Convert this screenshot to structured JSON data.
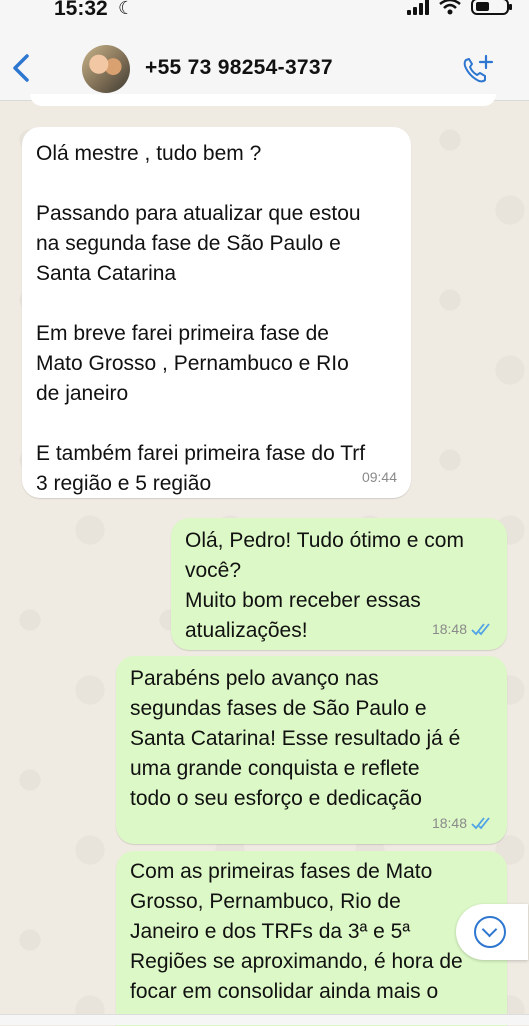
{
  "status_bar": {
    "time": "15:32",
    "moon": "☾",
    "icons": [
      "moon-icon",
      "signal-icon",
      "wifi-icon",
      "battery-icon"
    ]
  },
  "header": {
    "contact_name": "+55 73 98254-3737",
    "back_icon": "chevron-left-icon",
    "call_icon": "add-call-icon"
  },
  "messages": [
    {
      "direction": "incoming",
      "text": "Olá mestre , tudo bem ?\n\nPassando para atualizar que estou\nna segunda fase de São Paulo e\nSanta Catarina\n\nEm breve farei primeira fase de\nMato Grosso , Pernambuco e RIo\nde janeiro\n\nE também farei primeira fase do Trf\n3 região e 5 região",
      "time": "09:44"
    },
    {
      "direction": "outgoing",
      "text": "Olá, Pedro! Tudo ótimo e com\nvocê?\nMuito bom receber essas\natualizações!",
      "time": "18:48",
      "read": true
    },
    {
      "direction": "outgoing",
      "text": "Parabéns pelo avanço nas\nsegundas fases de São Paulo e\nSanta Catarina! Esse resultado já é\numa grande conquista e reflete\ntodo o seu esforço e dedicação",
      "time": "18:48",
      "read": true
    },
    {
      "direction": "outgoing",
      "text": "Com as primeiras fases de Mato\nGrosso, Pernambuco, Rio de\nJaneiro e dos TRFs da 3ª e 5ª\nRegiões se aproximando, é hora de\nfocar em consolidar ainda mais o"
    }
  ],
  "colors": {
    "incoming_bg": "#ffffff",
    "outgoing_bg": "#dcf8c6",
    "accent": "#2e77d0",
    "chat_bg": "#efeae2"
  }
}
